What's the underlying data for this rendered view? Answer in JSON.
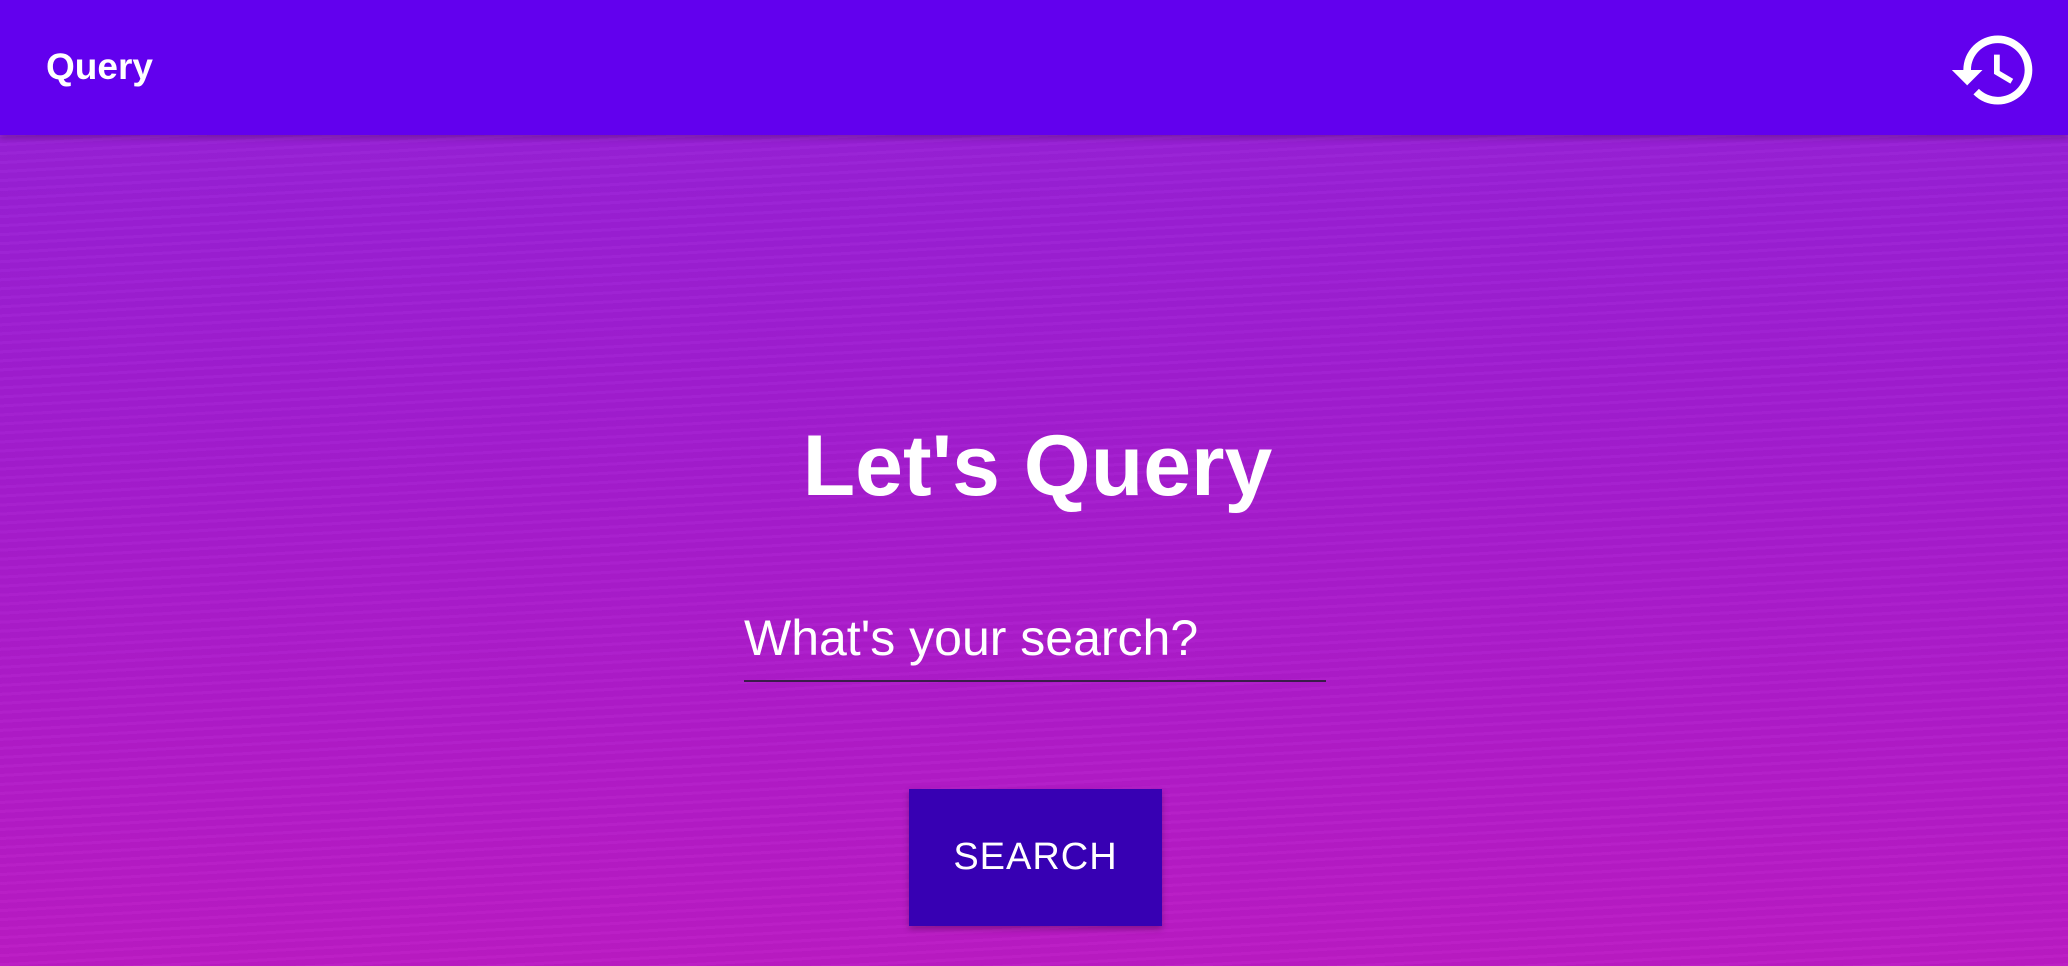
{
  "app_bar": {
    "title": "Query",
    "history_icon": "history-icon"
  },
  "main": {
    "heading": "Let's Query",
    "search": {
      "placeholder": "What's your search?",
      "value": ""
    },
    "search_button_label": "SEARCH"
  },
  "colors": {
    "app_bar": "#6200ee",
    "button": "#3700b3",
    "background_top": "#9322d9",
    "background_bottom": "#bb1ac4",
    "text": "#ffffff"
  }
}
